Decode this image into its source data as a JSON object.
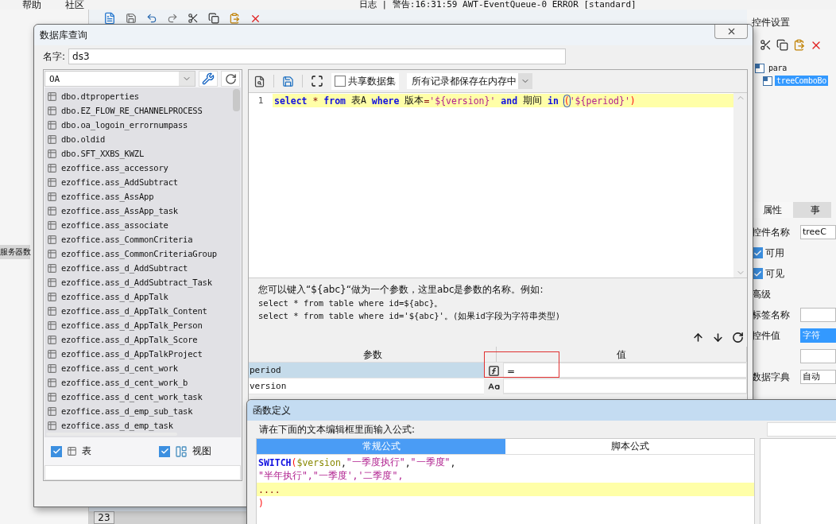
{
  "menu": [
    "帮助",
    "社区"
  ],
  "log": "日志 | 警告:16:31:59 AWT-EventQueue-0 ERROR [standard]",
  "side_label": "服务器数",
  "row_number": "23",
  "right_panel": {
    "title": "控件设置",
    "tree": [
      {
        "label": "para",
        "selected": false,
        "children": [
          {
            "label": "treeComboBo",
            "selected": true
          }
        ]
      }
    ],
    "tabs": [
      {
        "label": "属性",
        "selected": true
      },
      {
        "label": "事",
        "selected": false
      }
    ],
    "rows": [
      {
        "kind": "field",
        "label": "控件名称",
        "value": "treeC"
      },
      {
        "kind": "check",
        "label": "可用",
        "checked": true
      },
      {
        "kind": "check",
        "label": "可见",
        "checked": true
      },
      {
        "kind": "heading",
        "label": "高级"
      },
      {
        "kind": "field",
        "label": "标签名称"
      },
      {
        "kind": "combo",
        "label": "控件值",
        "value": "字符"
      },
      {
        "kind": "field"
      },
      {
        "kind": "field",
        "label": "数据字典",
        "value": "自动"
      }
    ]
  },
  "query_dialog": {
    "title": "数据库查询",
    "name_label": "名字:",
    "name_value": "ds3",
    "connection": "OA",
    "tables": [
      "dbo.dtproperties",
      "dbo.EZ_FLOW_RE_CHANNELPROCESS",
      "dbo.oa_logoin_errornumpass",
      "dbo.oldid",
      "dbo.SFT_XXBS_KWZL",
      "ezoffice.ass_accessory",
      "ezoffice.ass_AddSubtract",
      "ezoffice.ass_AssApp",
      "ezoffice.ass_AssApp_task",
      "ezoffice.ass_associate",
      "ezoffice.ass_CommonCriteria",
      "ezoffice.ass_CommonCriteriaGroup",
      "ezoffice.ass_d_AddSubtract",
      "ezoffice.ass_d_AddSubtract_Task",
      "ezoffice.ass_d_AppTalk",
      "ezoffice.ass_d_AppTalk_Content",
      "ezoffice.ass_d_AppTalk_Person",
      "ezoffice.ass_d_AppTalk_Score",
      "ezoffice.ass_d_AppTalkProject",
      "ezoffice.ass_d_cent_work",
      "ezoffice.ass_d_cent_work_b",
      "ezoffice.ass_d_cent_work_task",
      "ezoffice.ass_d_emp_sub_task",
      "ezoffice.ass_d_emp_task"
    ],
    "filters": [
      {
        "kind": "table",
        "label": "表",
        "checked": true
      },
      {
        "kind": "view",
        "label": "视图",
        "checked": true
      }
    ],
    "shared_dataset": {
      "label": "共享数据集",
      "checked": false
    },
    "storage": "所有记录都保存在内存中",
    "sql": {
      "line_number": "1",
      "tokens": [
        {
          "kind": "keyword",
          "text": "select"
        },
        {
          "kind": "operator",
          "text": " * "
        },
        {
          "kind": "keyword",
          "text": "from"
        },
        {
          "kind": "plain",
          "text": " 表A "
        },
        {
          "kind": "keyword",
          "text": "where"
        },
        {
          "kind": "plain",
          "text": " 版本"
        },
        {
          "kind": "operator",
          "text": "="
        },
        {
          "kind": "string",
          "text": "'${version}'"
        },
        {
          "kind": "keyword",
          "text": " and"
        },
        {
          "kind": "plain",
          "text": " 期间 "
        },
        {
          "kind": "keyword",
          "text": "in "
        },
        {
          "kind": "paren",
          "text": "(",
          "circled": true
        },
        {
          "kind": "string",
          "text": "'${period}'"
        },
        {
          "kind": "paren",
          "text": ")"
        }
      ]
    },
    "help": [
      "您可以键入“${abc}“做为一个参数，这里abc是参数的名称。例如:",
      "select * from table where id=${abc}。",
      "select * from table where id='${abc}'。(如果id字段为字符串类型)"
    ],
    "params": {
      "columns": [
        "参数",
        "值"
      ],
      "rows": [
        {
          "name": "period",
          "kind": "formula",
          "value": "=",
          "selected": true,
          "boxed": true
        },
        {
          "name": "version",
          "kind": "text",
          "selected": false,
          "boxed": false
        }
      ]
    }
  },
  "formula_dialog": {
    "title": "函数定义",
    "prompt": "请在下面的文本编辑框里面输入公式:",
    "tabs": [
      {
        "label": "常规公式",
        "selected": true
      },
      {
        "label": "脚本公式",
        "selected": false
      }
    ],
    "lines": [
      {
        "highlighted": false,
        "tokens": [
          {
            "kind": "keyword",
            "text": "SWITCH"
          },
          {
            "kind": "paren",
            "text": "("
          },
          {
            "kind": "variable",
            "text": "$version"
          },
          {
            "kind": "plain",
            "text": ","
          },
          {
            "kind": "string",
            "text": "\"一季度执行\""
          },
          {
            "kind": "plain",
            "text": ","
          },
          {
            "kind": "string",
            "text": "\"一季度\""
          },
          {
            "kind": "plain",
            "text": ","
          }
        ]
      },
      {
        "highlighted": false,
        "tokens": [
          {
            "kind": "string",
            "text": "\"半年执行\",\"一季度','二季度\","
          }
        ]
      },
      {
        "highlighted": true,
        "tokens": [
          {
            "kind": "operator",
            "text": "...."
          }
        ]
      },
      {
        "highlighted": false,
        "tokens": [
          {
            "kind": "paren",
            "text": ")"
          }
        ]
      }
    ]
  }
}
